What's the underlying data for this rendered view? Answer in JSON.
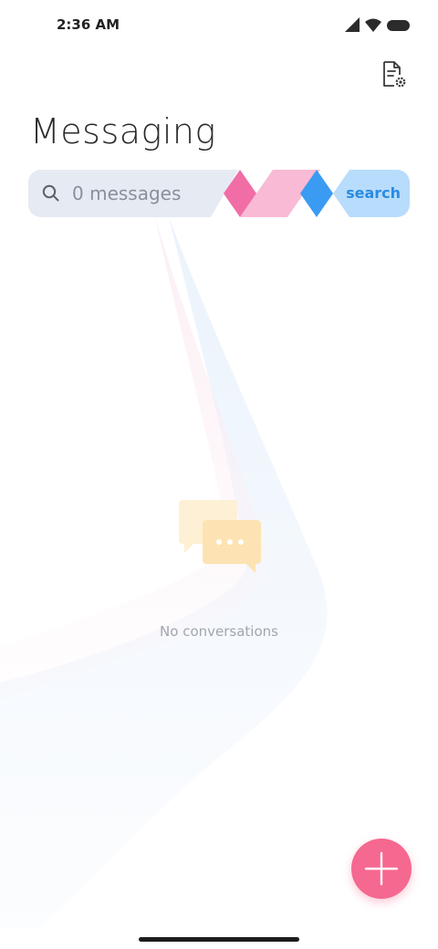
{
  "status_bar": {
    "time": "2:36 AM",
    "icons": [
      "signal-icon",
      "wifi-icon",
      "battery-icon"
    ]
  },
  "header": {
    "title": "Messaging",
    "settings_icon": "document-settings-icon"
  },
  "search": {
    "placeholder": "0 messages",
    "action_label": "search"
  },
  "empty_state": {
    "icon": "chat-bubbles-icon",
    "message": "No conversations"
  },
  "fab": {
    "icon": "plus-icon"
  },
  "colors": {
    "accent_pink": "#f5688f",
    "search_blue": "#2a8be0",
    "search_bg": "#e6eaf2"
  }
}
